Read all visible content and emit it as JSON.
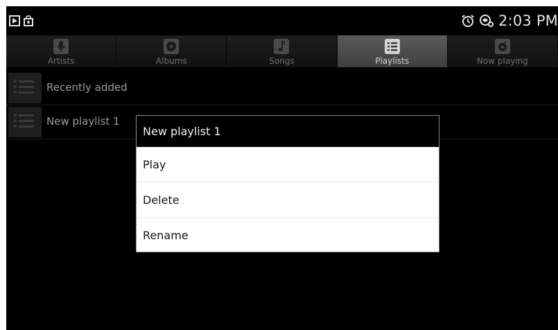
{
  "status_bar": {
    "time": "2:03 PM",
    "left_icons": [
      "play-store-icon",
      "shopping-bag-icon"
    ],
    "right_icons": [
      "alarm-clock-icon",
      "sync-icon"
    ]
  },
  "tabs": [
    {
      "label": "Artists",
      "icon": "microphone-icon",
      "active": false
    },
    {
      "label": "Albums",
      "icon": "disc-icon",
      "active": false
    },
    {
      "label": "Songs",
      "icon": "music-note-icon",
      "active": false
    },
    {
      "label": "Playlists",
      "icon": "list-icon",
      "active": true
    },
    {
      "label": "Now playing",
      "icon": "speaker-icon",
      "active": false
    }
  ],
  "playlists": [
    {
      "label": "Recently added"
    },
    {
      "label": "New playlist 1"
    }
  ],
  "context_menu": {
    "title": "New playlist 1",
    "items": [
      {
        "label": "Play"
      },
      {
        "label": "Delete"
      },
      {
        "label": "Rename"
      }
    ]
  },
  "colors": {
    "background": "#000000",
    "active_tab": "#4f4f4f",
    "dialog": "#ffffff",
    "dialog_title": "#000000"
  }
}
